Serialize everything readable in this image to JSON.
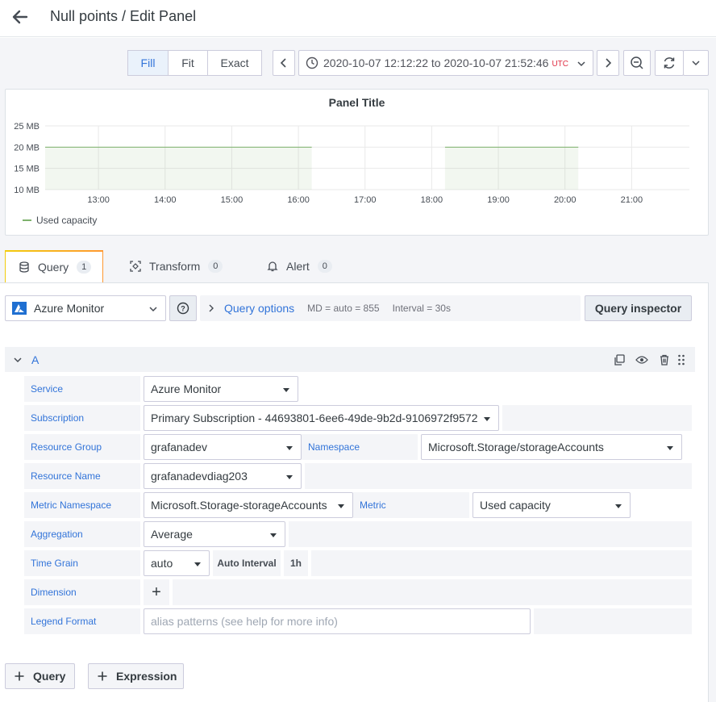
{
  "header": {
    "title": "Null points / Edit Panel"
  },
  "time_controls": {
    "fill_modes": [
      {
        "label": "Fill",
        "active": true
      },
      {
        "label": "Fit",
        "active": false
      },
      {
        "label": "Exact",
        "active": false
      }
    ],
    "range_text": "2020-10-07 12:12:22 to 2020-10-07 21:52:46",
    "timezone": "UTC"
  },
  "panel": {
    "title": "Panel Title",
    "legend": "Used capacity"
  },
  "chart_data": {
    "type": "line",
    "title": "Panel Title",
    "y_ticks": [
      "25 MB",
      "20 MB",
      "15 MB",
      "10 MB"
    ],
    "x_ticks": [
      "13:00",
      "14:00",
      "15:00",
      "16:00",
      "17:00",
      "18:00",
      "19:00",
      "20:00",
      "21:00"
    ],
    "ylim": [
      10,
      25
    ],
    "series": [
      {
        "name": "Used capacity",
        "color": "#7eb26d",
        "segments": [
          {
            "x_start": "12:12",
            "x_end": "16:12",
            "value": 20
          },
          {
            "x_start": "18:12",
            "x_end": "20:12",
            "value": 20
          }
        ]
      }
    ],
    "grid": true,
    "legend_position": "bottom-left"
  },
  "tabs": [
    {
      "label": "Query",
      "count": "1",
      "active": true
    },
    {
      "label": "Transform",
      "count": "0",
      "active": false
    },
    {
      "label": "Alert",
      "count": "0",
      "active": false
    }
  ],
  "datasource": {
    "name": "Azure Monitor"
  },
  "query_options": {
    "label": "Query options",
    "md": "MD = auto = 855",
    "interval": "Interval = 30s"
  },
  "query_inspector": "Query inspector",
  "query_row": {
    "ref_id": "A"
  },
  "fields": {
    "service": {
      "label": "Service",
      "value": "Azure Monitor"
    },
    "subscription": {
      "label": "Subscription",
      "value": "Primary Subscription - 44693801-6ee6-49de-9b2d-9106972f9572"
    },
    "resource_group": {
      "label": "Resource Group",
      "value": "grafanadev"
    },
    "namespace": {
      "label": "Namespace",
      "value": "Microsoft.Storage/storageAccounts"
    },
    "resource_name": {
      "label": "Resource Name",
      "value": "grafanadevdiag203"
    },
    "metric_namespace": {
      "label": "Metric Namespace",
      "value": "Microsoft.Storage-storageAccounts"
    },
    "metric": {
      "label": "Metric",
      "value": "Used capacity"
    },
    "aggregation": {
      "label": "Aggregation",
      "value": "Average"
    },
    "time_grain": {
      "label": "Time Grain",
      "value": "auto",
      "auto_interval_label": "Auto Interval",
      "auto_interval_value": "1h"
    },
    "dimension": {
      "label": "Dimension",
      "add": "+"
    },
    "legend_format": {
      "label": "Legend Format",
      "placeholder": "alias patterns (see help for more info)"
    }
  },
  "actions": {
    "add_query": "Query",
    "add_expression": "Expression"
  },
  "colors": {
    "accent": "#3274d9",
    "series": "#7eb26d",
    "utc": "#e02f44"
  }
}
